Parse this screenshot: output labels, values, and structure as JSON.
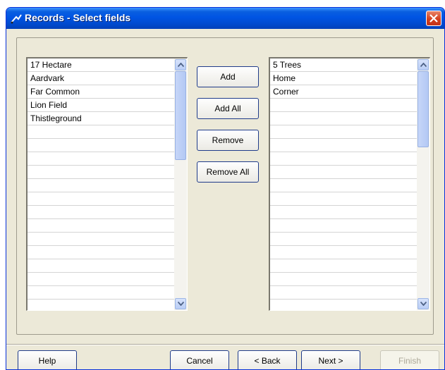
{
  "window": {
    "title": "Records - Select fields"
  },
  "left_list": {
    "items": [
      "17 Hectare",
      "Aardvark",
      "Far Common",
      "Lion Field",
      "Thistleground"
    ]
  },
  "right_list": {
    "items": [
      "5 Trees",
      "Home",
      "Corner"
    ]
  },
  "middle_buttons": {
    "add": "Add",
    "add_all": "Add All",
    "remove": "Remove",
    "remove_all": "Remove All"
  },
  "footer": {
    "help": "Help",
    "cancel": "Cancel",
    "back": "< Back",
    "next": "Next >",
    "finish": "Finish"
  },
  "colors": {
    "title_bar": "#0054e3",
    "close_button": "#d4401d",
    "dialog_bg": "#ece9d8"
  },
  "icons": [
    "title-icon",
    "close-icon",
    "scroll-up-icon",
    "scroll-down-icon"
  ]
}
